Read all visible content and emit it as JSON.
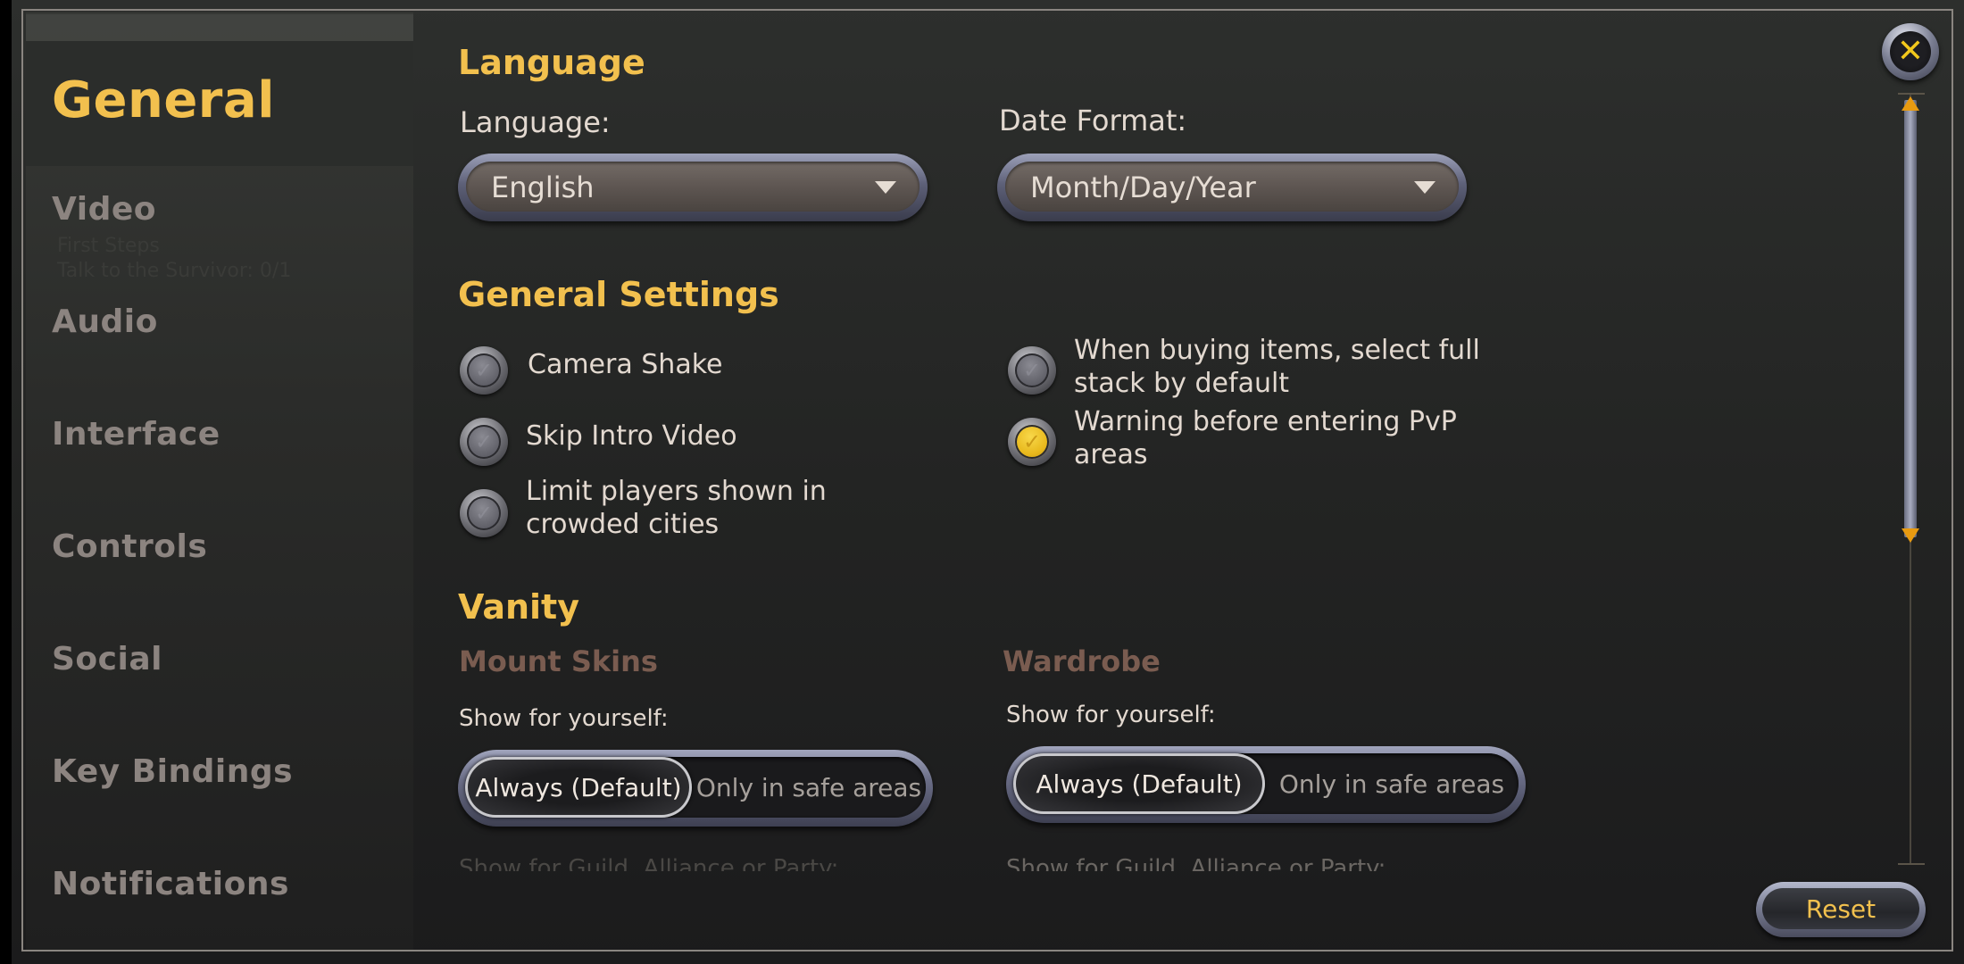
{
  "sidebar": {
    "items": [
      {
        "label": "General",
        "active": true
      },
      {
        "label": "Video"
      },
      {
        "label": "Audio"
      },
      {
        "label": "Interface"
      },
      {
        "label": "Controls"
      },
      {
        "label": "Social"
      },
      {
        "label": "Key Bindings"
      },
      {
        "label": "Notifications"
      }
    ],
    "ghost_lines": [
      "First Steps",
      "Talk to the Survivor: 0/1"
    ]
  },
  "language_section": {
    "title": "Language",
    "language": {
      "label": "Language:",
      "value": "English"
    },
    "date_format": {
      "label": "Date Format:",
      "value": "Month/Day/Year"
    }
  },
  "general_settings": {
    "title": "General Settings",
    "options": [
      {
        "label": "Camera Shake",
        "checked": false
      },
      {
        "label": "Skip Intro Video",
        "checked": false
      },
      {
        "label": "Limit players shown in crowded cities",
        "checked": false
      },
      {
        "label": "When buying items, select full stack by default",
        "checked": false
      },
      {
        "label": "Warning before entering PvP areas",
        "checked": true
      }
    ]
  },
  "vanity": {
    "title": "Vanity",
    "mount_skins": {
      "title": "Mount Skins",
      "show_for_yourself": "Show for yourself:",
      "options": [
        "Always (Default)",
        "Only in safe areas"
      ],
      "selected": "Always (Default)",
      "next_label": "Show for Guild, Alliance or Party:"
    },
    "wardrobe": {
      "title": "Wardrobe",
      "show_for_yourself": "Show for yourself:",
      "options": [
        "Always (Default)",
        "Only in safe areas"
      ],
      "selected": "Always (Default)",
      "next_label": "Show for Guild, Alliance or Party:"
    }
  },
  "buttons": {
    "close_glyph": "✕",
    "reset_label": "Reset"
  },
  "icons": {
    "check": "✓"
  },
  "colors": {
    "accent_gold": "#f2c04e",
    "subheading_brown": "#7a5c50",
    "nav_inactive": "#8c8480",
    "checked_yellow": "#e8b81c"
  }
}
